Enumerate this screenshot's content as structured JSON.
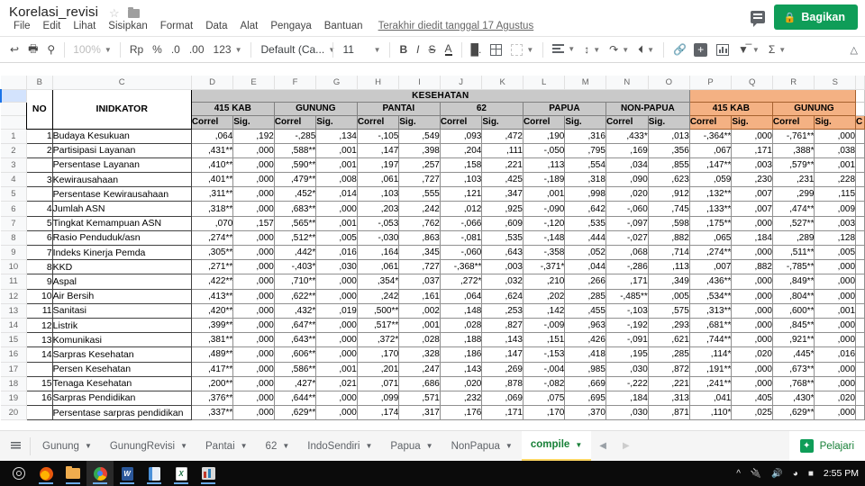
{
  "titlebar": {
    "doc_title": "Korelasi_revisi",
    "star_icon": "star-icon",
    "folder_icon": "folder-icon",
    "menus": [
      "File",
      "Edit",
      "Lihat",
      "Sisipkan",
      "Format",
      "Data",
      "Alat",
      "Pengaya",
      "Bantuan"
    ],
    "last_edit": "Terakhir diedit tanggal 17 Agustus",
    "comment_icon": "comment-icon",
    "share_label": "Bagikan",
    "share_lock_icon": "lock-icon",
    "share_color": "#0f9d58"
  },
  "toolbar": {
    "undo_icon": "undo-icon",
    "print_icon": "print-icon",
    "paint_format_icon": "paint-format-icon",
    "zoom_value": "100%",
    "currency_label": "Rp",
    "percent_label": "%",
    "dec_dec_label": ".0",
    "dec_inc_label": ".00",
    "format_label": "123",
    "font_name": "Default (Ca...",
    "font_size": "11",
    "bold_label": "B",
    "italic_label": "I",
    "strike_label": "S",
    "text_color_label": "A",
    "fill_icon": "fill-color-icon",
    "borders_icon": "borders-icon",
    "merge_icon": "merge-cells-icon",
    "halign_icon": "horizontal-align-icon",
    "valign_icon": "vertical-align-icon",
    "wrap_icon": "text-wrap-icon",
    "rotate_icon": "text-rotation-icon",
    "link_icon": "insert-link-icon",
    "comment_icon": "insert-comment-icon",
    "chart_icon": "insert-chart-icon",
    "filter_icon": "filter-icon",
    "functions_icon": "functions-sigma-icon",
    "collapse_icon": "collapse-toolbar-icon"
  },
  "sheet": {
    "column_letters": [
      "B",
      "C",
      "D",
      "E",
      "F",
      "G",
      "H",
      "I",
      "J",
      "K",
      "L",
      "M",
      "N",
      "O",
      "P",
      "Q",
      "R",
      "S"
    ],
    "selected_row_number": "",
    "header": {
      "section_title": "KESEHATAN",
      "section_color": "#c9c9c9",
      "highlight_color": "#f4b183",
      "label_no": "NO",
      "label_indicator": "INIDKATOR",
      "groups_gray": [
        "415 KAB",
        "GUNUNG",
        "PANTAI",
        "62",
        "PAPUA",
        "NON-PAPUA"
      ],
      "groups_orange": [
        "415 KAB",
        "GUNUNG"
      ],
      "sub_correl": "Correl",
      "sub_sig": "Sig."
    },
    "rows": [
      {
        "no": "1",
        "indicator": "Budaya Kesukuan",
        "vals": [
          ",064",
          ",192",
          "-,285",
          ",134",
          "-,105",
          ",549",
          ",093",
          ",472",
          ",190",
          ",316",
          ",433*",
          ",013",
          "-,364**",
          ",000",
          "-,761**",
          ",000"
        ]
      },
      {
        "no": "2",
        "indicator": "Partisipasi Layanan",
        "vals": [
          ",431**",
          ",000",
          ",588**",
          ",001",
          ",147",
          ",398",
          ",204",
          ",111",
          "-,050",
          ",795",
          ",169",
          ",356",
          ",067",
          ",171",
          ",388*",
          ",038"
        ]
      },
      {
        "no": "",
        "indicator": "Persentase Layanan",
        "vals": [
          ",410**",
          ",000",
          ",590**",
          ",001",
          ",197",
          ",257",
          ",158",
          ",221",
          ",113",
          ",554",
          ",034",
          ",855",
          ",147**",
          ",003",
          ",579**",
          ",001"
        ]
      },
      {
        "no": "3",
        "indicator": "Kewirausahaan",
        "vals": [
          ",401**",
          ",000",
          ",479**",
          ",008",
          ",061",
          ",727",
          ",103",
          ",425",
          "-,189",
          ",318",
          ",090",
          ",623",
          ",059",
          ",230",
          ",231",
          ",228"
        ]
      },
      {
        "no": "",
        "indicator": "Persentase Kewirausahaan",
        "vals": [
          ",311**",
          ",000",
          ",452*",
          ",014",
          ",103",
          ",555",
          ",121",
          ",347",
          ",001",
          ",998",
          ",020",
          ",912",
          ",132**",
          ",007",
          ",299",
          ",115"
        ]
      },
      {
        "no": "4",
        "indicator": "Jumlah ASN",
        "vals": [
          ",318**",
          ",000",
          ",683**",
          ",000",
          ",203",
          ",242",
          ",012",
          ",925",
          "-,090",
          ",642",
          "-,060",
          ",745",
          ",133**",
          ",007",
          ",474**",
          ",009"
        ]
      },
      {
        "no": "5",
        "indicator": "Tingkat Kemampuan ASN",
        "vals": [
          ",070",
          ",157",
          ",565**",
          ",001",
          "-,053",
          ",762",
          "-,066",
          ",609",
          "-,120",
          ",535",
          "-,097",
          ",598",
          ",175**",
          ",000",
          ",527**",
          ",003"
        ]
      },
      {
        "no": "6",
        "indicator": "Rasio Penduduk/asn",
        "vals": [
          ",274**",
          ",000",
          ",512**",
          ",005",
          "-,030",
          ",863",
          "-,081",
          ",535",
          "-,148",
          ",444",
          "-,027",
          ",882",
          ",065",
          ",184",
          ",289",
          ",128"
        ]
      },
      {
        "no": "7",
        "indicator": "Indeks Kinerja Pemda",
        "vals": [
          ",305**",
          ",000",
          ",442*",
          ",016",
          ",164",
          ",345",
          "-,060",
          ",643",
          "-,358",
          ",052",
          ",068",
          ",714",
          ",274**",
          ",000",
          ",511**",
          ",005"
        ]
      },
      {
        "no": "8",
        "indicator": "KKD",
        "vals": [
          ",271**",
          ",000",
          "-,403*",
          ",030",
          ",061",
          ",727",
          "-,368**",
          ",003",
          "-,371*",
          ",044",
          "-,286",
          ",113",
          ",007",
          ",882",
          "-,785**",
          ",000"
        ]
      },
      {
        "no": "9",
        "indicator": "Aspal",
        "vals": [
          ",422**",
          ",000",
          ",710**",
          ",000",
          ",354*",
          ",037",
          ",272*",
          ",032",
          ",210",
          ",266",
          ",171",
          ",349",
          ",436**",
          ",000",
          ",849**",
          ",000"
        ]
      },
      {
        "no": "10",
        "indicator": "Air Bersih",
        "vals": [
          ",413**",
          ",000",
          ",622**",
          ",000",
          ",242",
          ",161",
          ",064",
          ",624",
          ",202",
          ",285",
          "-,485**",
          ",005",
          ",534**",
          ",000",
          ",804**",
          ",000"
        ]
      },
      {
        "no": "11",
        "indicator": "Sanitasi",
        "vals": [
          ",420**",
          ",000",
          ",432*",
          ",019",
          ",500**",
          ",002",
          ",148",
          ",253",
          ",142",
          ",455",
          "-,103",
          ",575",
          ",313**",
          ",000",
          ",600**",
          ",001"
        ]
      },
      {
        "no": "12",
        "indicator": "Listrik",
        "vals": [
          ",399**",
          ",000",
          ",647**",
          ",000",
          ",517**",
          ",001",
          ",028",
          ",827",
          "-,009",
          ",963",
          "-,192",
          ",293",
          ",681**",
          ",000",
          ",845**",
          ",000"
        ]
      },
      {
        "no": "13",
        "indicator": "Komunikasi",
        "vals": [
          ",381**",
          ",000",
          ",643**",
          ",000",
          ",372*",
          ",028",
          ",188",
          ",143",
          ",151",
          ",426",
          "-,091",
          ",621",
          ",744**",
          ",000",
          ",921**",
          ",000"
        ]
      },
      {
        "no": "14",
        "indicator": "Sarpras Kesehatan",
        "vals": [
          ",489**",
          ",000",
          ",606**",
          ",000",
          ",170",
          ",328",
          ",186",
          ",147",
          "-,153",
          ",418",
          ",195",
          ",285",
          ",114*",
          ",020",
          ",445*",
          ",016"
        ]
      },
      {
        "no": "",
        "indicator": "Persen Kesehatan",
        "vals": [
          ",417**",
          ",000",
          ",586**",
          ",001",
          ",201",
          ",247",
          ",143",
          ",269",
          "-,004",
          ",985",
          ",030",
          ",872",
          ",191**",
          ",000",
          ",673**",
          ",000"
        ]
      },
      {
        "no": "15",
        "indicator": "Tenaga Kesehatan",
        "vals": [
          ",200**",
          ",000",
          ",427*",
          ",021",
          ",071",
          ",686",
          ",020",
          ",878",
          "-,082",
          ",669",
          "-,222",
          ",221",
          ",241**",
          ",000",
          ",768**",
          ",000"
        ]
      },
      {
        "no": "16",
        "indicator": "Sarpras Pendidikan",
        "vals": [
          ",376**",
          ",000",
          ",644**",
          ",000",
          ",099",
          ",571",
          ",232",
          ",069",
          ",075",
          ",695",
          ",184",
          ",313",
          ",041",
          ",405",
          ",430*",
          ",020"
        ]
      },
      {
        "no": "",
        "indicator": "Persentase sarpras pendidikan",
        "vals": [
          ",337**",
          ",000",
          ",629**",
          ",000",
          ",174",
          ",317",
          ",176",
          ",171",
          ",170",
          ",370",
          ",030",
          ",871",
          ",110*",
          ",025",
          ",629**",
          ",000"
        ]
      }
    ]
  },
  "tabbar": {
    "all_sheets_icon": "all-sheets-icon",
    "tabs": [
      "Gunung",
      "GunungRevisi",
      "Pantai",
      "62",
      "IndoSendiri",
      "Papua",
      "NonPapua",
      "compile"
    ],
    "active_tab": "compile",
    "prev_icon": "prev-sheet-icon",
    "next_icon": "next-sheet-icon",
    "explore_label": "Pelajari",
    "explore_icon": "explore-icon"
  },
  "taskbar": {
    "icons": [
      "cortana-icon",
      "firefox-icon",
      "file-explorer-icon",
      "chrome-icon",
      "word-icon",
      "document-icon",
      "excel-icon",
      "spss-icon"
    ],
    "tray_icons": [
      "show-hidden-icons-icon",
      "usb-icon",
      "volume-icon",
      "wifi-icon",
      "battery-icon"
    ],
    "clock": "2:55 PM"
  }
}
